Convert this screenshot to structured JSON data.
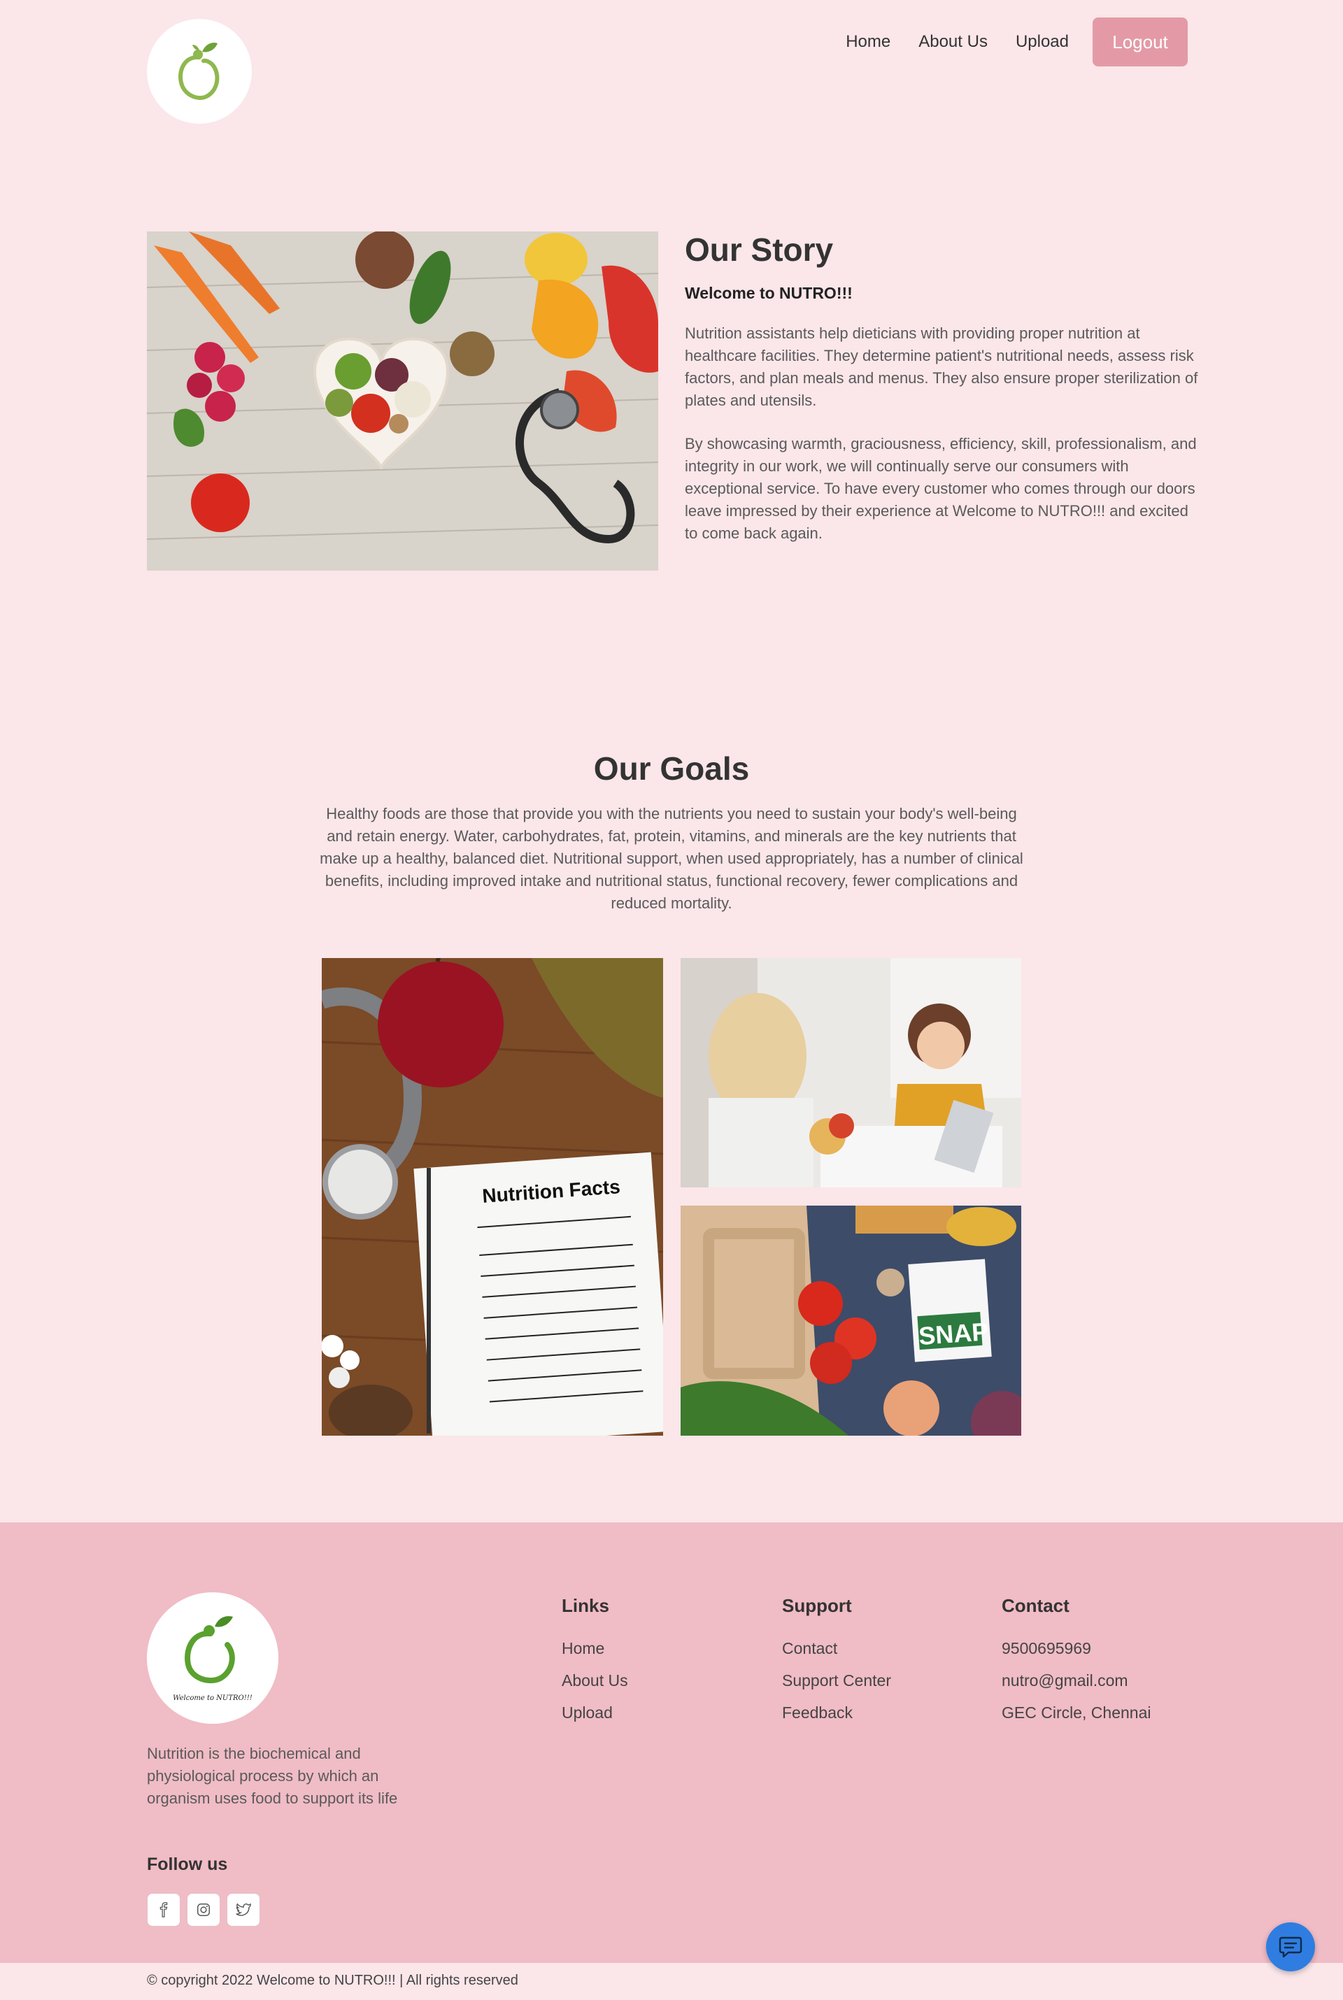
{
  "header": {
    "logo_icon": "apple-logo-icon",
    "nav": [
      {
        "label": "Home"
      },
      {
        "label": "About Us"
      },
      {
        "label": "Upload"
      }
    ],
    "logout_label": "Logout"
  },
  "story": {
    "image_icon": "healthy-food-heart-bowl-image",
    "title": "Our Story",
    "subtitle": "Welcome to NUTRO!!!",
    "paragraph1": "Nutrition assistants help dieticians with providing proper nutrition at healthcare facilities. They determine patient's nutritional needs, assess risk factors, and plan meals and menus. They also ensure proper sterilization of plates and utensils.",
    "paragraph2": "By showcasing warmth, graciousness, efficiency, skill, professionalism, and integrity in our work, we will continually serve our consumers with exceptional service. To have every customer who comes through our doors leave impressed by their experience at Welcome to NUTRO!!! and excited to come back again."
  },
  "goals": {
    "title": "Our Goals",
    "paragraph": "Healthy foods are those that provide you with the nutrients you need to sustain your body's well-being and retain energy. Water, carbohydrates, fat, protein, vitamins, and minerals are the key nutrients that make up a healthy, balanced diet. Nutritional support, when used appropriately, has a number of clinical benefits, including improved intake and nutritional status, functional recovery, fewer complications and reduced mortality.",
    "images": {
      "nutrition_label_title": "Nutrition Facts",
      "snap_text": "SNAP"
    }
  },
  "footer": {
    "logo_text": "Welcome to NUTRO!!!",
    "description": "Nutrition is the biochemical and physiological process by which an organism uses food to support its life",
    "follow_title": "Follow us",
    "social": [
      "facebook-icon",
      "instagram-icon",
      "twitter-icon"
    ],
    "links": {
      "title": "Links",
      "items": [
        "Home",
        "About Us",
        "Upload"
      ]
    },
    "support": {
      "title": "Support",
      "items": [
        "Contact",
        "Support Center",
        "Feedback"
      ]
    },
    "contact": {
      "title": "Contact",
      "phone": "9500695969",
      "email": "nutro@gmail.com",
      "address": "GEC Circle, Chennai"
    },
    "copyright": "© copyright 2022 Welcome to NUTRO!!! | All rights reserved"
  },
  "colors": {
    "page_bg": "#fbe6e9",
    "footer_bg": "#f0bcc5",
    "logout_bg": "#e39aa6",
    "chat_button": "#2f7de1"
  },
  "chat_icon": "chat-bubble-icon"
}
